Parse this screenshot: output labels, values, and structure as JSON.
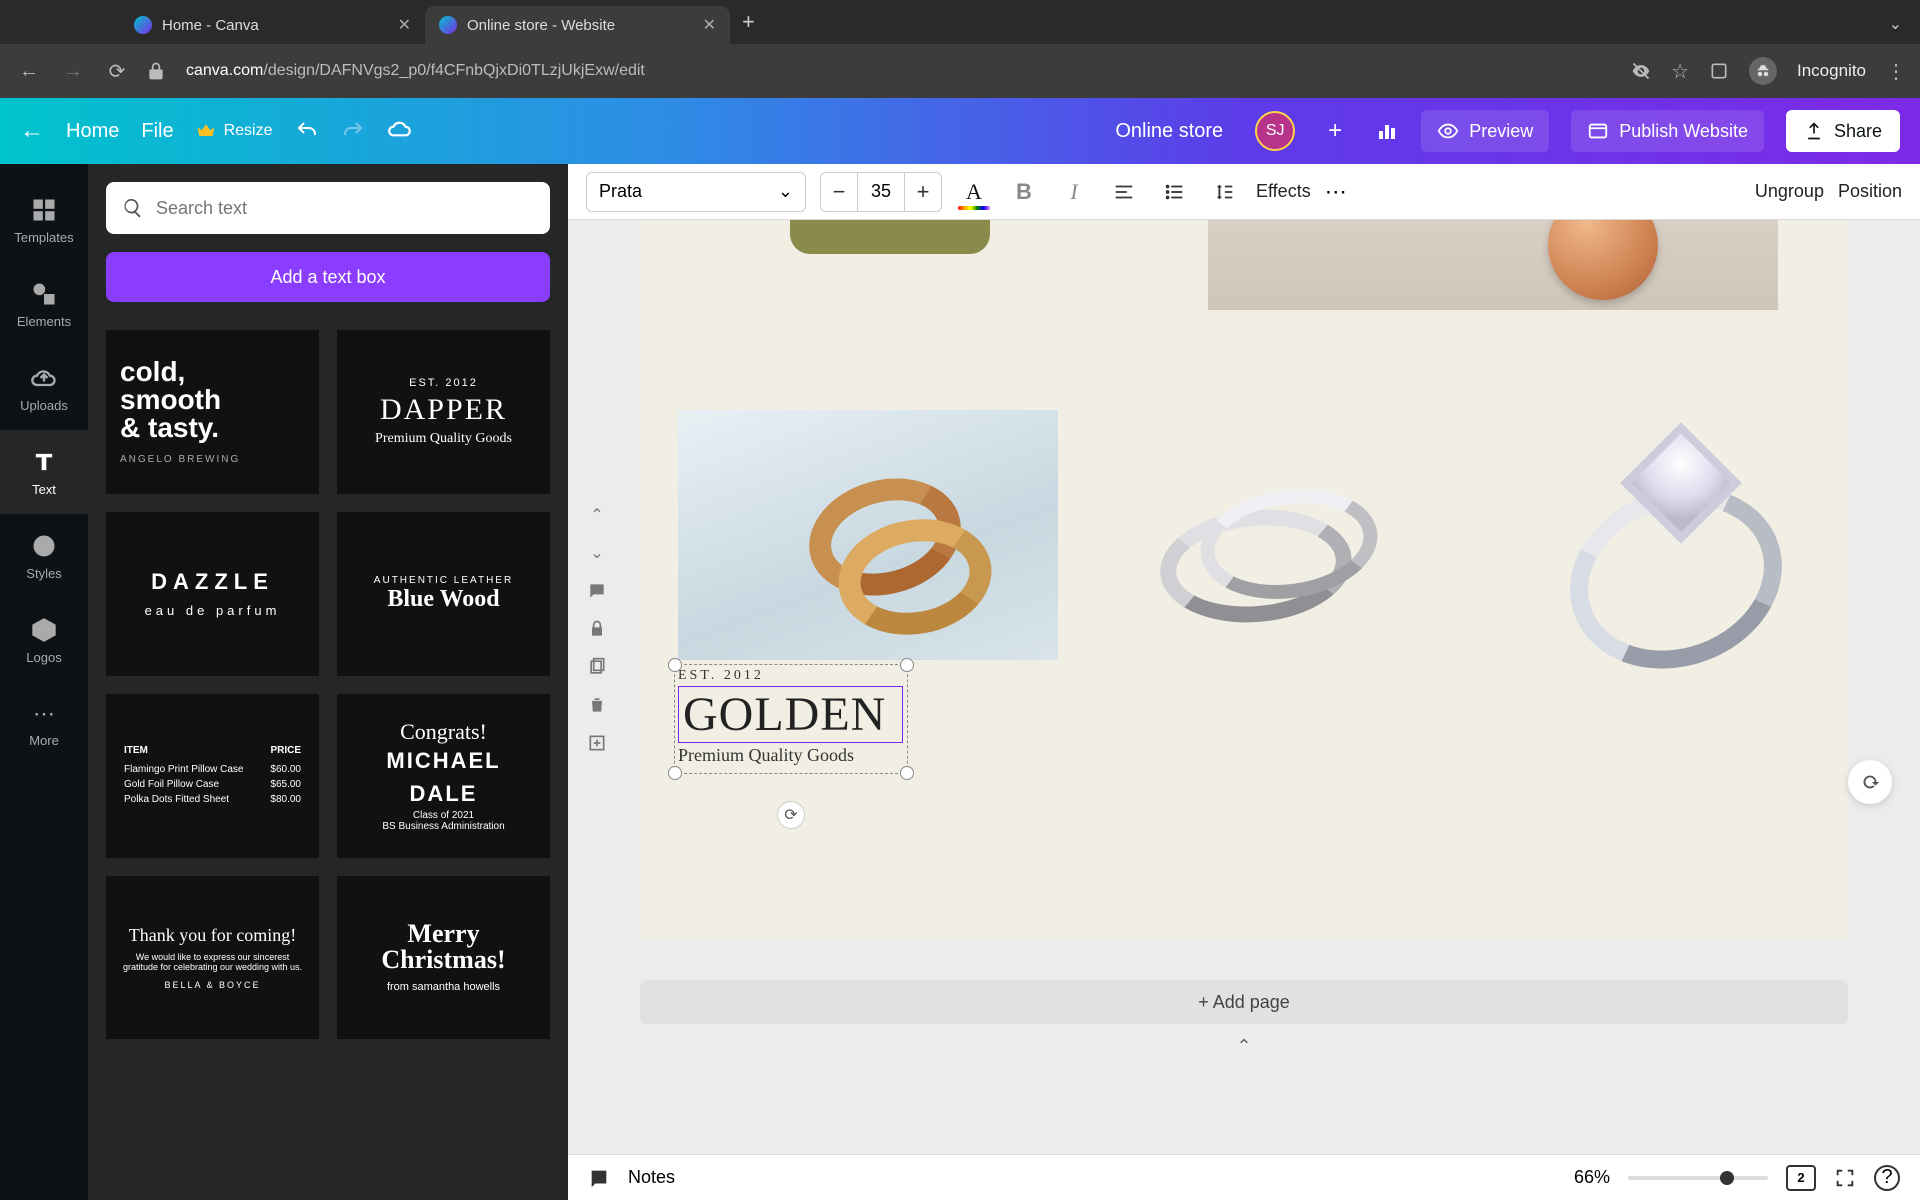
{
  "browser": {
    "tabs": [
      {
        "title": "Home - Canva"
      },
      {
        "title": "Online store - Website"
      }
    ],
    "url_host": "canva.com",
    "url_path": "/design/DAFNVgs2_p0/f4CFnbQjxDi0TLzjUkjExw/edit",
    "incognito_label": "Incognito"
  },
  "topbar": {
    "home": "Home",
    "file": "File",
    "resize": "Resize",
    "doc_title": "Online store",
    "avatar_initials": "SJ",
    "preview": "Preview",
    "publish": "Publish Website",
    "share": "Share"
  },
  "rail": {
    "templates": "Templates",
    "elements": "Elements",
    "uploads": "Uploads",
    "text": "Text",
    "styles": "Styles",
    "logos": "Logos",
    "more": "More"
  },
  "panel": {
    "search_placeholder": "Search text",
    "add_text": "Add a text box",
    "cards": {
      "cold": {
        "l1": "cold,",
        "l2": "smooth",
        "l3": "& tasty.",
        "sub": "ANGELO BREWING"
      },
      "dapper": {
        "est": "EST. 2012",
        "big": "DAPPER",
        "sub": "Premium Quality Goods"
      },
      "dazzle": {
        "big": "DAZZLE",
        "sub": "eau de parfum"
      },
      "bluewood": {
        "est": "AUTHENTIC LEATHER",
        "big": "Blue Wood"
      },
      "menu": {
        "hdr_item": "ITEM",
        "hdr_price": "PRICE",
        "r1a": "Flamingo Print Pillow Case",
        "r1b": "$60.00",
        "r2a": "Gold Foil Pillow Case",
        "r2b": "$65.00",
        "r3a": "Polka Dots Fitted Sheet",
        "r3b": "$80.00"
      },
      "congrats": {
        "cursive": "Congrats!",
        "l1": "MICHAEL",
        "l2": "DALE",
        "s1": "Class of 2021",
        "s2": "BS Business Administration"
      },
      "thanks": {
        "cursive": "Thank you for coming!",
        "sub": "We would like to express our sincerest gratitude for celebrating our wedding with us.",
        "sig": "BELLA & BOYCE"
      },
      "merry": {
        "l1": "Merry",
        "l2": "Christmas!",
        "sub": "from samantha howells"
      }
    }
  },
  "ctx": {
    "font": "Prata",
    "size": "35",
    "effects": "Effects",
    "ungroup": "Ungroup",
    "position": "Position"
  },
  "canvas": {
    "sel": {
      "est": "EST. 2012",
      "big": "GOLDEN",
      "sub": "Premium Quality Goods"
    },
    "add_page": "+ Add page"
  },
  "bottom": {
    "notes": "Notes",
    "zoom": "66%",
    "page_badge": "2"
  }
}
